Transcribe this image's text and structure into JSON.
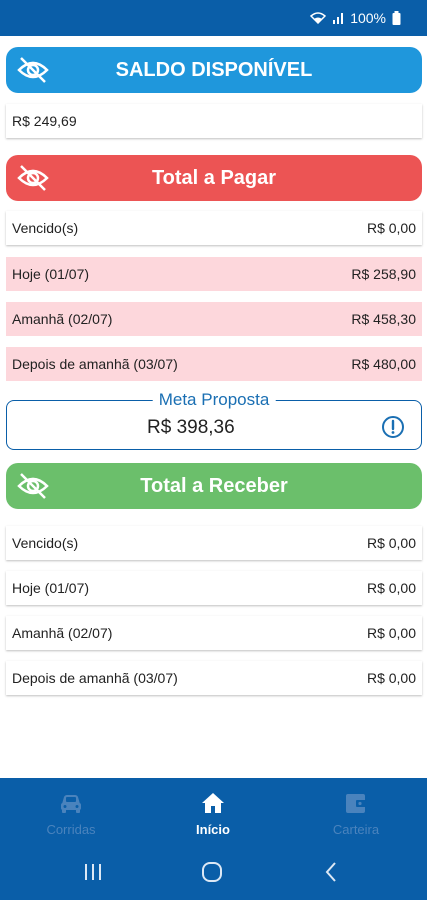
{
  "status_bar": {
    "battery_text": "100%"
  },
  "saldo": {
    "title": "SALDO DISPONÍVEL",
    "value": "R$ 249,69"
  },
  "pagar": {
    "title": "Total a Pagar",
    "rows": [
      {
        "label": "Vencido(s)",
        "value": "R$ 0,00",
        "highlight": false
      },
      {
        "label": "Hoje (01/07)",
        "value": "R$ 258,90",
        "highlight": true
      },
      {
        "label": "Amanhã (02/07)",
        "value": "R$ 458,30",
        "highlight": true
      },
      {
        "label": "Depois de amanhã (03/07)",
        "value": "R$ 480,00",
        "highlight": true
      }
    ]
  },
  "meta": {
    "label": "Meta Proposta",
    "value": "R$ 398,36"
  },
  "receber": {
    "title": "Total a Receber",
    "rows": [
      {
        "label": "Vencido(s)",
        "value": "R$ 0,00"
      },
      {
        "label": "Hoje (01/07)",
        "value": "R$ 0,00"
      },
      {
        "label": "Amanhã (02/07)",
        "value": "R$ 0,00"
      },
      {
        "label": "Depois de amanhã (03/07)",
        "value": "R$ 0,00"
      }
    ]
  },
  "bottom_nav": {
    "items": [
      {
        "label": "Corridas",
        "icon": "car-icon",
        "active": false
      },
      {
        "label": "Início",
        "icon": "home-icon",
        "active": true
      },
      {
        "label": "Carteira",
        "icon": "wallet-icon",
        "active": false
      }
    ]
  },
  "colors": {
    "brand_blue": "#0a5ea8",
    "saldo_header": "#1f97dc",
    "pagar_header": "#ec5454",
    "receber_header": "#6bbf6b",
    "highlight_row": "#fdd7dc"
  }
}
